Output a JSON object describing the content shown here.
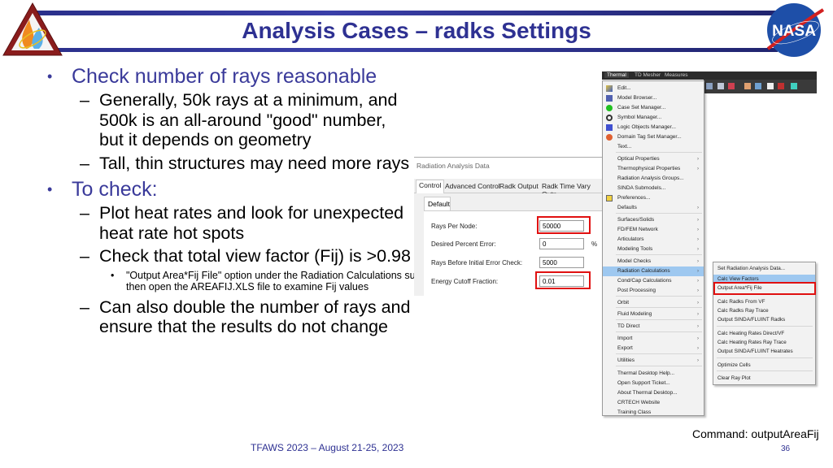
{
  "slide": {
    "title": "Analysis Cases – radks Settings",
    "logos": {
      "left": "Thermal & Fluids Analysis Workshop logo",
      "right": "NASA"
    },
    "bullets": [
      {
        "text": "Check number of rays reasonable",
        "children": [
          {
            "text": "Generally, 50k rays at a minimum, and 500k is an all-around \"good\" number, but it depends on geometry"
          },
          {
            "text": "Tall, thin structures may need more rays"
          }
        ]
      },
      {
        "text": "To check:",
        "children": [
          {
            "text": "Plot heat rates and look for unexpected heat rate hot spots"
          },
          {
            "text": "Check that total view factor (Fij) is >0.98",
            "children": [
              {
                "text": "\"Output Area*Fij File\" option under the Radiation Calculations submenu, then open the AREAFIJ.XLS file to examine Fij values"
              }
            ]
          },
          {
            "text": "Can also double the number of rays and ensure that the results do not change"
          }
        ]
      }
    ],
    "footer": "TFAWS 2023 – August 21-25, 2023",
    "command": "Command: outputAreaFij",
    "page_number": "36"
  },
  "dialog": {
    "title": "Radiation Analysis Data",
    "tabs": [
      "Control",
      "Advanced Control",
      "Radk Output",
      "Radk Time Vary Outp"
    ],
    "active_tab": "Control",
    "subtab": "Default",
    "fields": [
      {
        "label": "Rays Per Node:",
        "value": "50000",
        "unit": "",
        "highlighted": true
      },
      {
        "label": "Desired Percent Error:",
        "value": "0",
        "unit": "%",
        "highlighted": false
      },
      {
        "label": "Rays Before Initial Error Check:",
        "value": "5000",
        "unit": "",
        "highlighted": false
      },
      {
        "label": "Energy Cutoff Fraction:",
        "value": "0.01",
        "unit": "",
        "highlighted": true
      }
    ],
    "highlight_color": "#e01010"
  },
  "app": {
    "ribbon_tabs": [
      "Thermal",
      "TD Mesher",
      "Measures"
    ],
    "active_ribbon_tab": "Thermal",
    "menu": {
      "items": [
        {
          "label": "Edit...",
          "icon": "edit-icon",
          "submenu": false
        },
        {
          "label": "Model Browser...",
          "icon": "model-browser-icon",
          "submenu": false
        },
        {
          "label": "Case Set Manager...",
          "icon": "green-circle-icon",
          "submenu": false
        },
        {
          "label": "Symbol Manager...",
          "icon": "symbol-icon",
          "submenu": false
        },
        {
          "label": "Logic Objects Manager...",
          "icon": "logic-objects-icon",
          "submenu": false
        },
        {
          "label": "Domain Tag Set Manager...",
          "icon": "domain-tag-icon",
          "submenu": false
        },
        {
          "label": "Text...",
          "icon": "",
          "submenu": false
        },
        {
          "label": "Optical Properties",
          "icon": "",
          "submenu": true
        },
        {
          "label": "Thermophysical Properties",
          "icon": "",
          "submenu": true
        },
        {
          "label": "Radiation Analysis Groups...",
          "icon": "",
          "submenu": false
        },
        {
          "label": "SINDA Submodels...",
          "icon": "",
          "submenu": false
        },
        {
          "label": "Preferences...",
          "icon": "preferences-icon",
          "submenu": false
        },
        {
          "label": "Defaults",
          "icon": "",
          "submenu": true
        },
        {
          "label": "Surfaces/Solids",
          "icon": "",
          "submenu": true
        },
        {
          "label": "FD/FEM Network",
          "icon": "",
          "submenu": true
        },
        {
          "label": "Articulators",
          "icon": "",
          "submenu": true
        },
        {
          "label": "Modeling Tools",
          "icon": "",
          "submenu": true
        },
        {
          "label": "Model Checks",
          "icon": "",
          "submenu": true
        },
        {
          "label": "Radiation Calculations",
          "icon": "",
          "submenu": true,
          "selected": true
        },
        {
          "label": "Cond/Cap Calculations",
          "icon": "",
          "submenu": true
        },
        {
          "label": "Post Processing",
          "icon": "",
          "submenu": true
        },
        {
          "label": "Orbit",
          "icon": "",
          "submenu": true
        },
        {
          "label": "Fluid Modeling",
          "icon": "",
          "submenu": true
        },
        {
          "label": "TD Direct",
          "icon": "",
          "submenu": true
        },
        {
          "label": "Import",
          "icon": "",
          "submenu": true
        },
        {
          "label": "Export",
          "icon": "",
          "submenu": true
        },
        {
          "label": "Utilities",
          "icon": "",
          "submenu": true
        },
        {
          "label": "Thermal Desktop Help...",
          "icon": "",
          "submenu": false
        },
        {
          "label": "Open Support Ticket...",
          "icon": "",
          "submenu": false
        },
        {
          "label": "About Thermal Desktop...",
          "icon": "",
          "submenu": false
        },
        {
          "label": "CRTECH Website",
          "icon": "",
          "submenu": false
        },
        {
          "label": "Training Class",
          "icon": "",
          "submenu": false
        }
      ],
      "arrow": "›"
    },
    "submenu": {
      "items": [
        {
          "label": "Set Radiation Analysis Data..."
        },
        {
          "label": "Calc View Factors",
          "selected": true
        },
        {
          "label": "Output Area*Fij File",
          "highlighted": true
        },
        {
          "label": "Calc Radks From VF"
        },
        {
          "label": "Calc Radks Ray Trace"
        },
        {
          "label": "Output SINDA/FLUINT Radks"
        },
        {
          "label": "Calc Heating Rates Direct/VF"
        },
        {
          "label": "Calc Heating Rates Ray Trace"
        },
        {
          "label": "Output SINDA/FLUINT Heatrates"
        },
        {
          "label": "Optimize Cells"
        },
        {
          "label": "Clear Ray Plot"
        }
      ]
    }
  }
}
